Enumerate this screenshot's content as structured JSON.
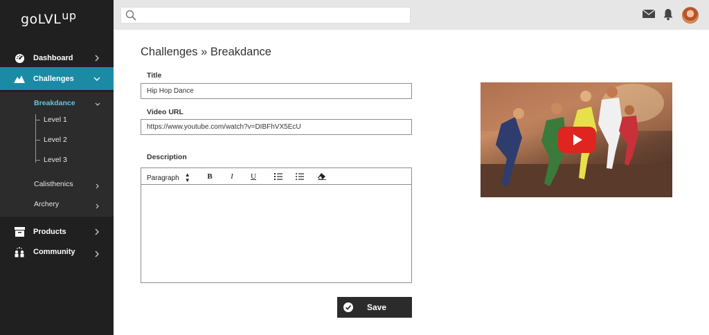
{
  "app": {
    "logo": "goLVL",
    "logo_sup": "up"
  },
  "sidebar": {
    "items": [
      {
        "label": "Dashboard",
        "icon": "dashboard-icon"
      },
      {
        "label": "Challenges",
        "icon": "mountain-icon",
        "active": true
      },
      {
        "label": "Products",
        "icon": "archive-icon"
      },
      {
        "label": "Community",
        "icon": "community-icon"
      }
    ],
    "sub": {
      "breakdance": "Breakdance",
      "levels": [
        "Level 1",
        "Level 2",
        "Level 3"
      ],
      "calisthenics": "Calisthenics",
      "archery": "Archery"
    },
    "colors": {
      "bg": "#202020",
      "active": "#1a8aa5",
      "active_text": "#5fc8e3"
    }
  },
  "topbar": {
    "search_value": "",
    "icons": [
      "search-icon",
      "mail-icon",
      "bell-icon",
      "avatar"
    ]
  },
  "page": {
    "title": "Challenges » Breakdance",
    "fields": {
      "title_label": "Title",
      "title_value": "Hip Hop Dance",
      "url_label": "Video URL",
      "url_value": "https://www.youtube.com/watch?v=DIBFhVX5EcU",
      "description_label": "Description"
    },
    "editor": {
      "format_select": "Paragraph",
      "buttons": [
        "bold-icon",
        "italic-icon",
        "underline-icon",
        "ordered-list-icon",
        "bullet-list-icon",
        "eraser-icon"
      ],
      "bold": "B",
      "italic": "I",
      "underline": "U"
    },
    "save_label": "Save"
  }
}
